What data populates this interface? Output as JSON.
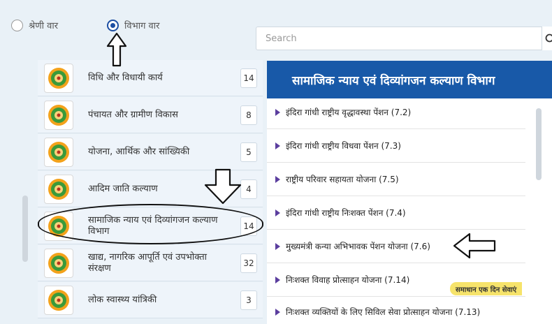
{
  "filter": {
    "options": [
      {
        "label": "श्रेणी वार",
        "checked": false
      },
      {
        "label": "विभाग वार",
        "checked": true
      }
    ]
  },
  "search": {
    "placeholder": "Search",
    "value": ""
  },
  "departments": [
    {
      "name": "विधि और विधायी कार्य",
      "count": "14"
    },
    {
      "name": "पंचायत और ग्रामीण विकास",
      "count": "8"
    },
    {
      "name": "योजना, आर्थिक और सांख्यिकी",
      "count": "5"
    },
    {
      "name": "आदिम जाति कल्याण",
      "count": "4"
    },
    {
      "name": "सामाजिक न्याय एवं दिव्यांगजन कल्याण विभाग",
      "count": "14"
    },
    {
      "name": "खाद्य, नागरिक आपूर्ति एवं उपभोक्ता संरक्षण",
      "count": "32"
    },
    {
      "name": "लोक स्वास्थ्य यांत्रिकी",
      "count": "3"
    }
  ],
  "panel": {
    "title": "सामाजिक न्याय एवं दिव्यांगजन कल्याण विभाग",
    "schemes": [
      "इंदिरा गांधी राष्ट्रीय वृद्धावस्था पेंशन (7.2)",
      "इंदिरा गांधी राष्ट्रीय विधवा पेंशन (7.3)",
      "राष्ट्रीय परिवार सहायता योजना (7.5)",
      "इंदिरा गांधी राष्ट्रीय निःशक्त पेंशन (7.4)",
      "मुख्यमंत्री कन्या अभिभावक पेंशन योजना (7.6)",
      "निःशक्त विवाह प्रोत्साहन योजना (7.14)",
      "निःशक्त व्यक्तियों के लिए सिविल सेवा प्रोत्साहन योजना (7.13)"
    ]
  },
  "badge": {
    "text": "समाधान एक दिन सेवाएं"
  },
  "icons": {
    "search": "search-icon",
    "logo": "mp-emblem-icon",
    "bullet": "triangle-bullet-icon",
    "annotation": "outline-arrow-icon"
  },
  "colors": {
    "header": "#1859a8",
    "radio": "#1d4fa3",
    "bullet": "#5b3e9e",
    "badge": "#f6e36b",
    "page_bg": "#e9f1f7"
  }
}
